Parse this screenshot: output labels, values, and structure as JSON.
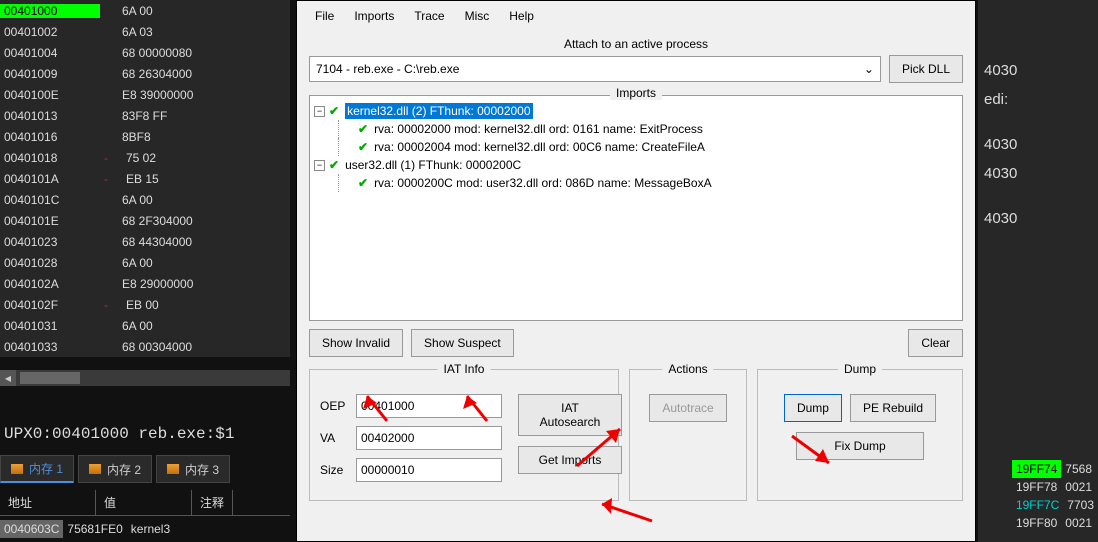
{
  "disasm": {
    "rows": [
      {
        "addr": "00401000",
        "bytes": "6A 00",
        "hl": true
      },
      {
        "addr": "00401002",
        "bytes": "6A 03"
      },
      {
        "addr": "00401004",
        "bytes": "68 00000080"
      },
      {
        "addr": "00401009",
        "bytes": "68 26304000"
      },
      {
        "addr": "0040100E",
        "bytes": "E8 39000000"
      },
      {
        "addr": "00401013",
        "bytes": "83F8 FF"
      },
      {
        "addr": "00401016",
        "bytes": "8BF8"
      },
      {
        "addr": "00401018",
        "bytes": "75 02",
        "mark": true
      },
      {
        "addr": "0040101A",
        "bytes": "EB 15",
        "mark": true
      },
      {
        "addr": "0040101C",
        "bytes": "6A 00"
      },
      {
        "addr": "0040101E",
        "bytes": "68 2F304000"
      },
      {
        "addr": "00401023",
        "bytes": "68 44304000"
      },
      {
        "addr": "00401028",
        "bytes": "6A 00"
      },
      {
        "addr": "0040102A",
        "bytes": "E8 29000000"
      },
      {
        "addr": "0040102F",
        "bytes": "EB 00",
        "mark": true
      },
      {
        "addr": "00401031",
        "bytes": "6A 00"
      },
      {
        "addr": "00401033",
        "bytes": "68 00304000"
      }
    ]
  },
  "status": "UPX0:00401000 reb.exe:$1",
  "memTabs": [
    "内存 1",
    "内存 2",
    "内存 3"
  ],
  "memHdr": {
    "c1": "地址",
    "c2": "值",
    "c3": "注释"
  },
  "memRow": {
    "c1": "0040603C",
    "c2": "75681FE0",
    "c3": "kernel3"
  },
  "rightReg": "4030",
  "rightRegs": [
    "edi:",
    "",
    "",
    "4030",
    "4030",
    "",
    "",
    "4030"
  ],
  "stack": [
    {
      "a": "19FF74",
      "v": "7568",
      "cls": "lime"
    },
    {
      "a": "19FF78",
      "v": "0021"
    },
    {
      "a": "19FF7C",
      "v": "7703",
      "cls": "cyan"
    },
    {
      "a": "19FF80",
      "v": "0021"
    }
  ],
  "menu": [
    "File",
    "Imports",
    "Trace",
    "Misc",
    "Help"
  ],
  "attach": {
    "label": "Attach to an active process",
    "combo": "7104 - reb.exe - C:\\reb.exe",
    "pick": "Pick DLL"
  },
  "importsLabel": "Imports",
  "tree": {
    "n1": "kernel32.dll (2) FThunk: 00002000",
    "n1a": "rva: 00002000 mod: kernel32.dll ord: 0161 name: ExitProcess",
    "n1b": "rva: 00002004 mod: kernel32.dll ord: 00C6 name: CreateFileA",
    "n2": "user32.dll (1) FThunk: 0000200C",
    "n2a": "rva: 0000200C mod: user32.dll ord: 086D name: MessageBoxA"
  },
  "btns": {
    "showInvalid": "Show Invalid",
    "showSuspect": "Show Suspect",
    "clear": "Clear"
  },
  "iat": {
    "title": "IAT Info",
    "oepL": "OEP",
    "oep": "00401000",
    "vaL": "VA",
    "va": "00402000",
    "sizeL": "Size",
    "size": "00000010",
    "auto": "IAT Autosearch",
    "get": "Get Imports"
  },
  "actions": {
    "title": "Actions",
    "auto": "Autotrace"
  },
  "dump": {
    "title": "Dump",
    "dump": "Dump",
    "rebuild": "PE Rebuild",
    "fix": "Fix Dump"
  }
}
